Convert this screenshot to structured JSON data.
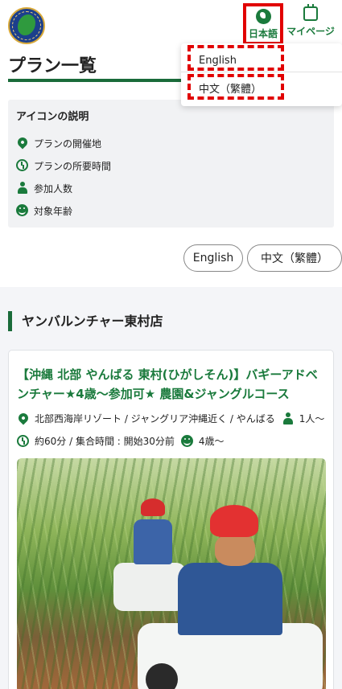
{
  "header": {
    "language_button_label": "日本語",
    "mypage_button_label": "マイページ"
  },
  "language_dropdown": {
    "items": [
      "English",
      "中文（繁體）"
    ]
  },
  "page": {
    "title": "プラン一覧"
  },
  "icon_legend": {
    "title": "アイコンの説明",
    "items": [
      {
        "icon": "location-pin-icon",
        "label": "プランの開催地"
      },
      {
        "icon": "clock-icon",
        "label": "プランの所要時間"
      },
      {
        "icon": "person-icon",
        "label": "参加人数"
      },
      {
        "icon": "smile-icon",
        "label": "対象年齢"
      }
    ]
  },
  "language_pills": [
    "English",
    "中文（繁體）"
  ],
  "shop": {
    "name": "ヤンバルンチャー東村店"
  },
  "plan_card": {
    "title": "【沖縄 北部 やんばる 東村(ひがしそん)】バギーアドベンチャー★4歳〜参加可★ 農園&ジャングルコース",
    "location": "北部西海岸リゾート / ジャングリア沖縄近く / やんばる",
    "participants": "1人〜",
    "duration": "約60分 / 集合時間 : 開始30分前",
    "age": "4歳〜"
  },
  "colors": {
    "brand_green": "#1a7a3c",
    "highlight_red": "#e10000"
  }
}
